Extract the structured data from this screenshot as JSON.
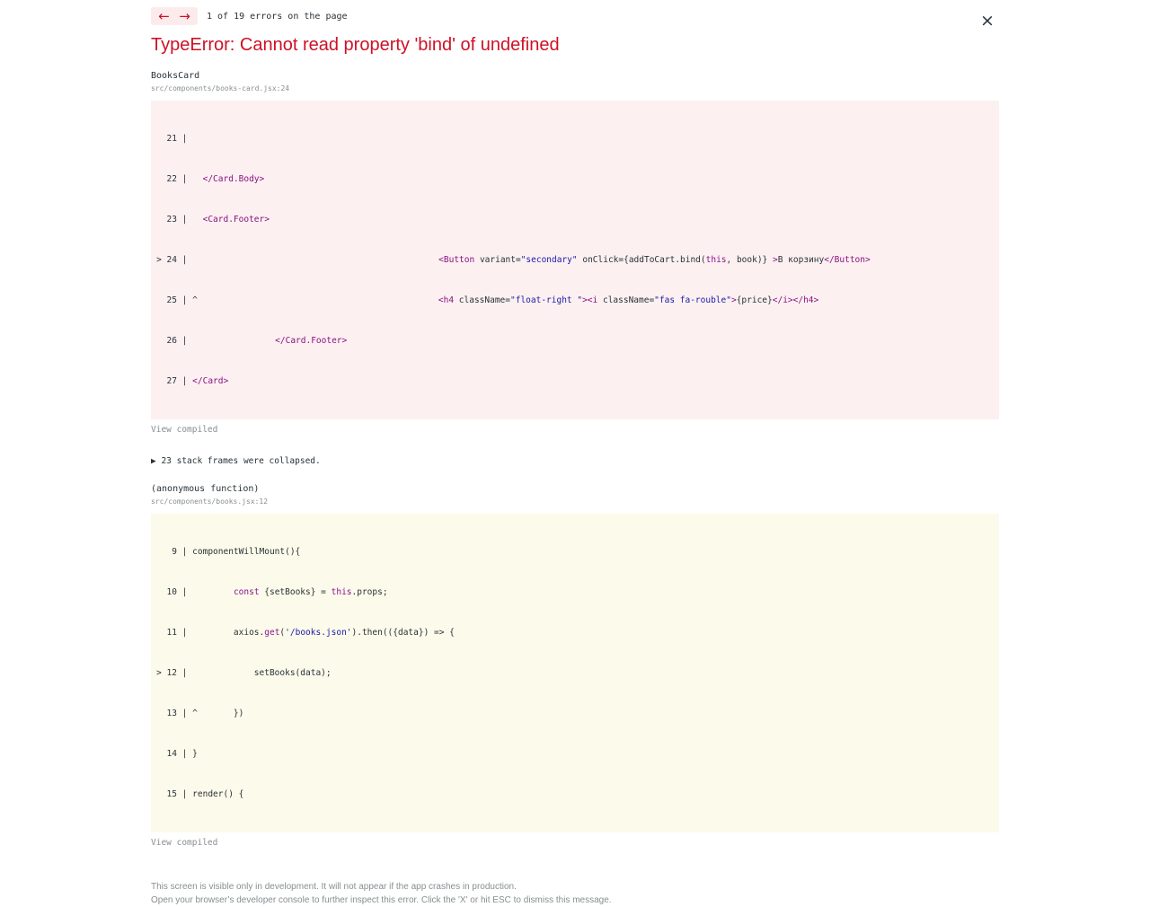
{
  "nav": {
    "prev_icon": "←",
    "next_icon": "→",
    "count_text": "1 of 19 errors on the page"
  },
  "close_icon": "×",
  "error": {
    "title": "TypeError: Cannot read property 'bind' of undefined"
  },
  "frames": [
    {
      "function": "BooksCard",
      "file": "src/components/books-card.jsx:24",
      "view_compiled": "View compiled"
    },
    {
      "function": "(anonymous function)",
      "file": "src/components/books.jsx:12",
      "view_compiled": "View compiled"
    }
  ],
  "collapsed_text": "▶ 23 stack frames were collapsed.",
  "footer": {
    "line1": "This screen is visible only in development. It will not appear if the app crashes in production.",
    "line2": "Open your browser’s developer console to further inspect this error.  Click the 'X' or hit ESC to dismiss this message."
  },
  "colors": {
    "error_red": "#ce1126",
    "pink_bg": "#fcf0f1",
    "yellow_bg": "#fcfaea",
    "muted": "#878e91"
  }
}
